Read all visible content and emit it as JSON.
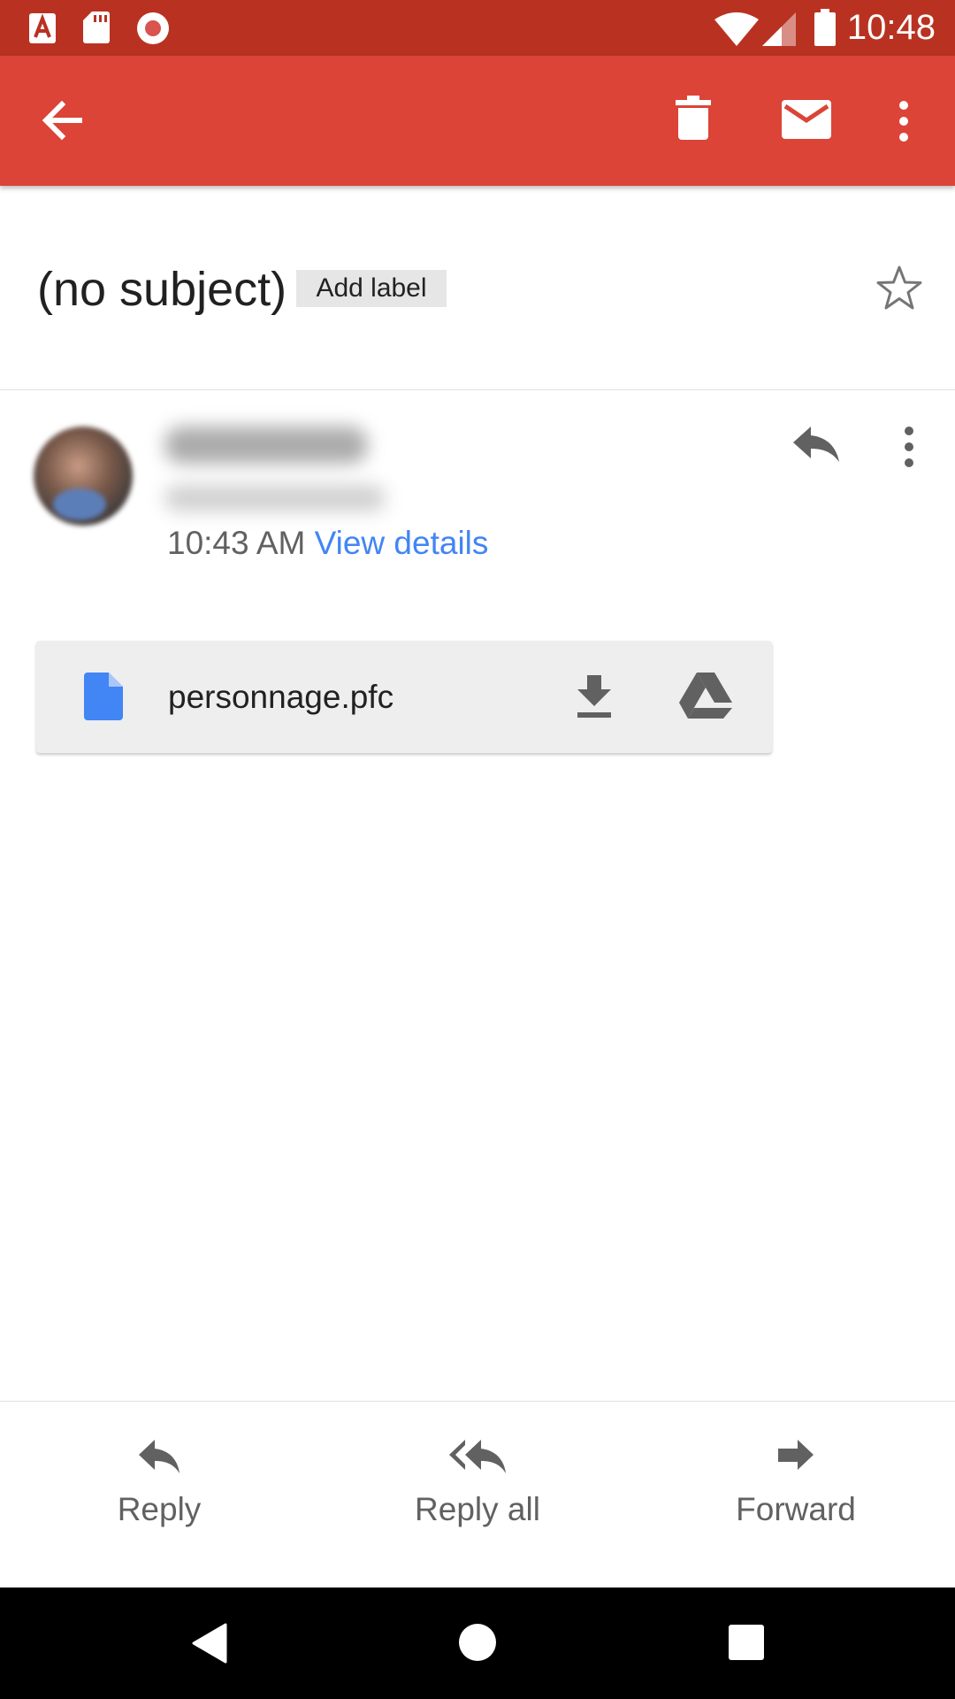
{
  "status_bar": {
    "time": "10:48",
    "icons_left": [
      "acrobat-notification-icon",
      "sd-card-icon",
      "record-icon"
    ],
    "icons_right": [
      "wifi-icon",
      "signal-icon",
      "battery-icon"
    ],
    "color": "#B93221"
  },
  "app_bar": {
    "color": "#DB4437",
    "actions": [
      "back-arrow-icon",
      "delete-icon",
      "mark-unread-icon",
      "more-options-icon"
    ]
  },
  "message": {
    "subject": "(no subject)",
    "add_label": "Add label",
    "time": "10:43 AM",
    "view_details": "View details"
  },
  "attachment": {
    "filename": "personnage.pfc"
  },
  "bottom_actions": {
    "reply": "Reply",
    "reply_all": "Reply all",
    "forward": "Forward"
  },
  "colors": {
    "link": "#4285F4",
    "file_icon": "#4285F4"
  }
}
